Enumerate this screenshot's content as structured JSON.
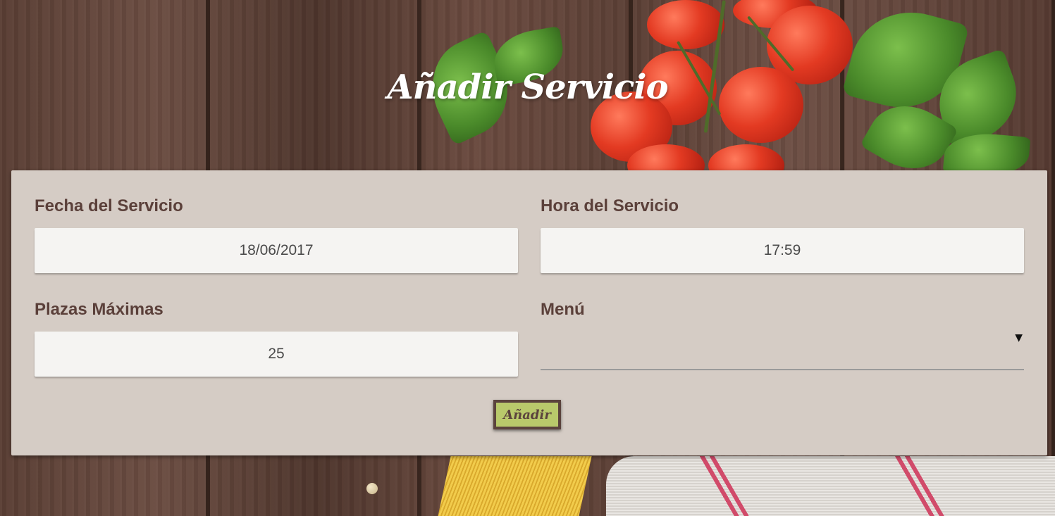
{
  "page": {
    "title": "Añadir Servicio"
  },
  "form": {
    "fecha": {
      "label": "Fecha del Servicio",
      "value": "18/06/2017"
    },
    "hora": {
      "label": "Hora del Servicio",
      "value": "17:59"
    },
    "plazas": {
      "label": "Plazas Máximas",
      "value": "25"
    },
    "menu": {
      "label": "Menú",
      "value": "",
      "arrow": "▼"
    },
    "submit_label": "Añadir"
  },
  "colors": {
    "card_bg": "#d5ccc5",
    "label_text": "#5b403a",
    "input_bg": "#f5f4f2",
    "button_bg": "#b9c96b",
    "button_border": "#5b433d"
  },
  "icons": {
    "menu_select": "dropdown-arrow-icon"
  }
}
